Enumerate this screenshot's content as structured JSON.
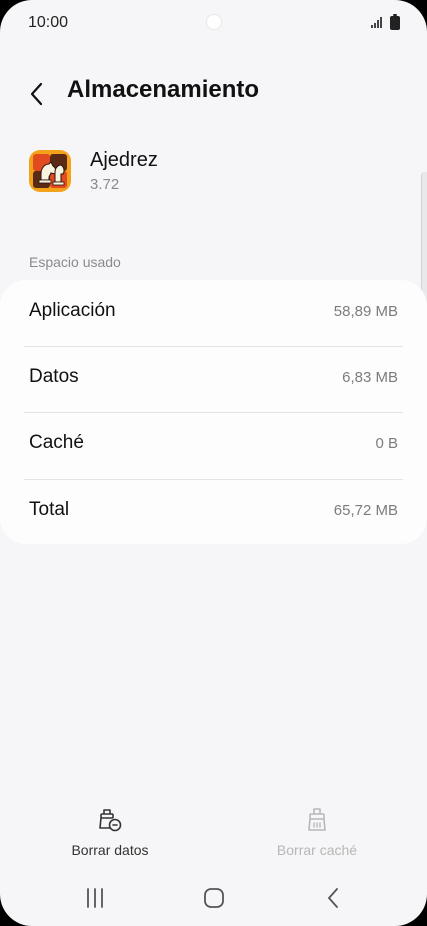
{
  "status_bar": {
    "time": "10:00"
  },
  "header": {
    "title": "Almacenamiento"
  },
  "app": {
    "name": "Ajedrez",
    "version": "3.72"
  },
  "storage": {
    "section_label": "Espacio usado",
    "rows": [
      {
        "label": "Aplicación",
        "value": "58,89 MB"
      },
      {
        "label": "Datos",
        "value": "6,83 MB"
      },
      {
        "label": "Caché",
        "value": "0 B"
      },
      {
        "label": "Total",
        "value": "65,72 MB"
      }
    ]
  },
  "actions": {
    "clear_data": "Borrar datos",
    "clear_cache": "Borrar caché"
  },
  "icons": {
    "back": "chevron-left-icon",
    "clear_data": "brush-trash-icon",
    "clear_cache": "brush-icon",
    "nav_recent": "recent-apps-icon",
    "nav_home": "home-icon",
    "nav_back": "back-icon"
  }
}
